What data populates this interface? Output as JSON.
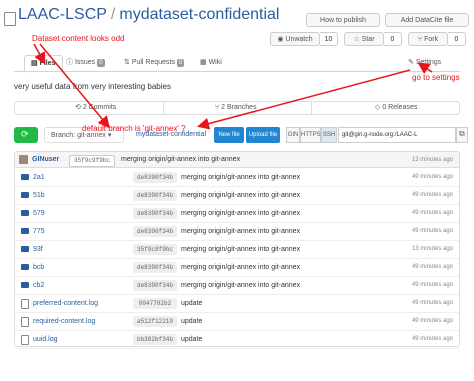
{
  "header": {
    "owner": "LAAC-LSCP",
    "separator": "/",
    "repo": "mydataset-confidential",
    "how_to_publish": "How to publish",
    "add_datacite": "Add DataCite file",
    "unwatch_label": "Unwatch",
    "unwatch_count": "10",
    "star_label": "Star",
    "star_count": "0",
    "fork_label": "Fork",
    "fork_count": "0"
  },
  "tabs": [
    {
      "label": "Files"
    },
    {
      "label": "Issues",
      "badge": "0"
    },
    {
      "label": "Pull Requests",
      "badge": "0"
    },
    {
      "label": "Wiki"
    },
    {
      "label": "Settings"
    }
  ],
  "description": "very useful data from very interesting babies",
  "stats": {
    "commits": "2 Commits",
    "branches": "2 Branches",
    "releases": "0 Releases"
  },
  "toolbar": {
    "branch_label": "Branch: git-annex",
    "repo_link": "mydataset-confidential",
    "new_file": "New file",
    "upload_file": "Upload file",
    "gin": "GIN",
    "https": "HTTPS",
    "ssh": "SSH",
    "clone_url": "git@gin.g-node.org:/LAAC-L"
  },
  "latest_commit": {
    "user": "GINuser",
    "sha": "35f9c9f9bc",
    "message": "merging origin/git-annex into git-annex",
    "age": "13 minutes ago"
  },
  "files": [
    {
      "name": "2a1",
      "type": "folder",
      "sha": "de8390f34b",
      "message": "merging origin/git-annex into git-annex",
      "age": "49 minutes ago"
    },
    {
      "name": "51b",
      "type": "folder",
      "sha": "de8390f34b",
      "message": "merging origin/git-annex into git-annex",
      "age": "49 minutes ago"
    },
    {
      "name": "579",
      "type": "folder",
      "sha": "de8390f34b",
      "message": "merging origin/git-annex into git-annex",
      "age": "49 minutes ago"
    },
    {
      "name": "775",
      "type": "folder",
      "sha": "de8390f34b",
      "message": "merging origin/git-annex into git-annex",
      "age": "49 minutes ago"
    },
    {
      "name": "93f",
      "type": "folder",
      "sha": "35f9c9f9bc",
      "message": "merging origin/git-annex into git-annex",
      "age": "13 minutes ago"
    },
    {
      "name": "bcb",
      "type": "folder",
      "sha": "de8390f34b",
      "message": "merging origin/git-annex into git-annex",
      "age": "49 minutes ago"
    },
    {
      "name": "cb2",
      "type": "folder",
      "sha": "de8390f34b",
      "message": "merging origin/git-annex into git-annex",
      "age": "49 minutes ago"
    },
    {
      "name": "preferred-content.log",
      "type": "file",
      "sha": "0047702b2",
      "message": "update",
      "age": "49 minutes ago"
    },
    {
      "name": "required-content.log",
      "type": "file",
      "sha": "a512f12219",
      "message": "update",
      "age": "49 minutes ago"
    },
    {
      "name": "uuid.log",
      "type": "file",
      "sha": "bb382bf34b",
      "message": "update",
      "age": "49 minutes ago"
    }
  ],
  "annotations": {
    "dataset_odd": "Dataset content looks odd",
    "goto_settings": "go to settings",
    "default_branch": "default branch is 'git-annex' ?"
  },
  "colors": {
    "annotation": "#e8141b",
    "link": "#2a5d9f",
    "primary": "#2185d0",
    "success": "#21ba45"
  }
}
